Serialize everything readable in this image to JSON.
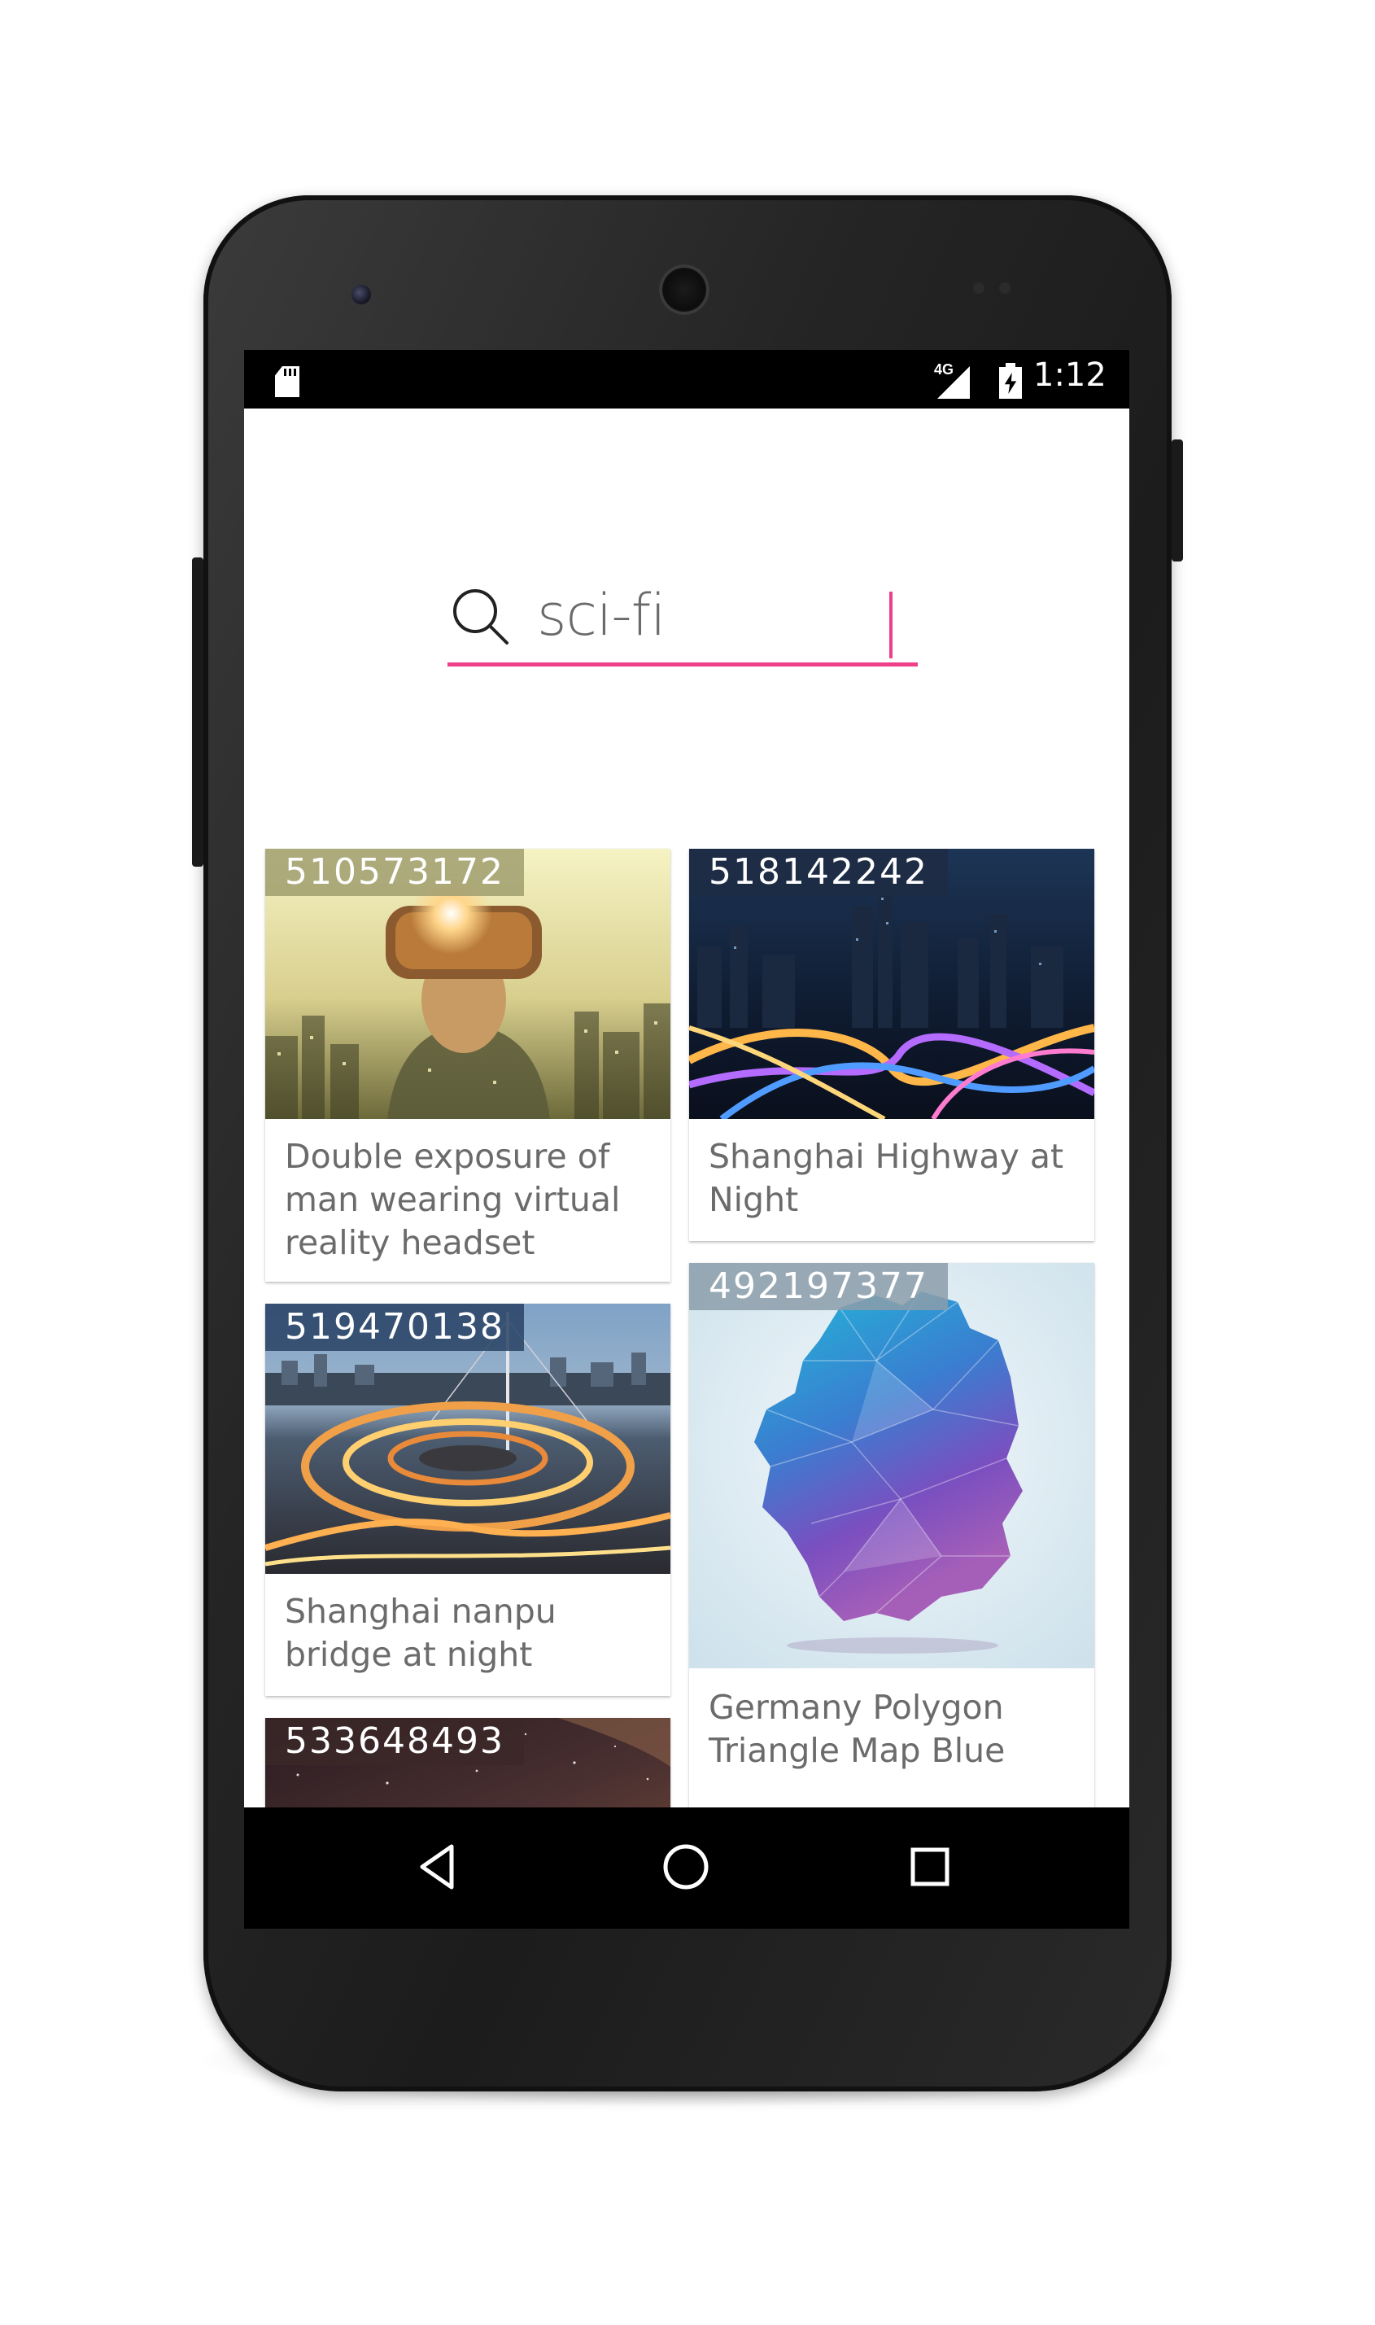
{
  "status_bar": {
    "network": "4G",
    "time": "1:12"
  },
  "search": {
    "value": "sci-fi",
    "accent_color": "#ef3f8b"
  },
  "results": [
    {
      "id": "510573172",
      "title": "Double exposure of man wearing virtual reality headset",
      "image": "vr-headset-double-exposure"
    },
    {
      "id": "518142242",
      "title": "Shanghai Highway at Night",
      "image": "shanghai-highway-night"
    },
    {
      "id": "519470138",
      "title": "Shanghai nanpu bridge at night",
      "image": "shanghai-nanpu-bridge"
    },
    {
      "id": "492197377",
      "title": "Germany Polygon Triangle Map Blue",
      "image": "germany-polygon-map"
    },
    {
      "id": "533648493",
      "title": "",
      "image": "starry-night-sky"
    }
  ],
  "nav": {
    "back_icon": "back-triangle-icon",
    "home_icon": "home-circle-icon",
    "recents_icon": "recents-square-icon"
  }
}
